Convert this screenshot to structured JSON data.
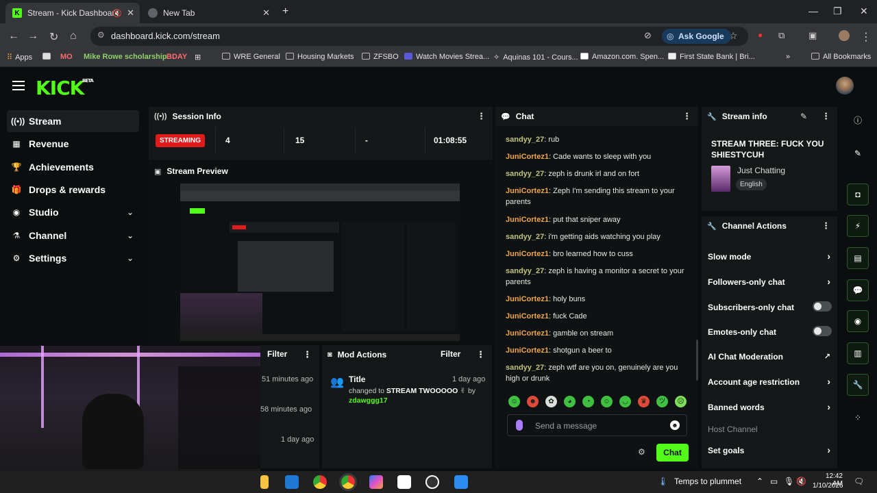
{
  "browser": {
    "tabs": [
      {
        "title": "Stream - Kick Dashboard",
        "active": true
      },
      {
        "title": "New Tab",
        "active": false
      }
    ],
    "url": "dashboard.kick.com/stream",
    "ask_google": "Ask Google",
    "bookmarks": [
      "Apps",
      "MO",
      "Mike Rowe scholarship",
      "BDAY",
      "WRE General",
      "Housing Markets",
      "ZFSBO",
      "Watch Movies Strea...",
      "Aquinas 101 - Cours...",
      "Amazon.com. Spen...",
      "First State Bank | Bri...",
      "All Bookmarks"
    ]
  },
  "app": {
    "logo": "KICK",
    "logo_beta": "BETA",
    "nav": [
      {
        "label": "Stream",
        "icon": "stream-icon",
        "active": true
      },
      {
        "label": "Revenue",
        "icon": "revenue-icon"
      },
      {
        "label": "Achievements",
        "icon": "trophy-icon"
      },
      {
        "label": "Drops & rewards",
        "icon": "gift-icon"
      },
      {
        "label": "Studio",
        "icon": "studio-icon",
        "expandable": true
      },
      {
        "label": "Channel",
        "icon": "channel-icon",
        "expandable": true
      },
      {
        "label": "Settings",
        "icon": "gear-icon",
        "expandable": true
      }
    ],
    "session": {
      "title": "Session Info",
      "status": "STREAMING",
      "viewers": "4",
      "followers": "15",
      "subs": "-",
      "duration": "01:08:55"
    },
    "preview": {
      "title": "Stream Preview"
    },
    "activity": {
      "filter_label": "Filter",
      "times": [
        "51 minutes ago",
        "58 minutes ago",
        "1 day ago"
      ]
    },
    "mod_actions": {
      "title": "Mod Actions",
      "filter_label": "Filter",
      "entry_title": "Title",
      "entry_time": "1 day ago",
      "entry_prefix": "changed to",
      "entry_value": "STREAM TWOOOOO",
      "entry_by": "by",
      "entry_user": "zdawggg17"
    },
    "chat": {
      "title": "Chat",
      "messages": [
        {
          "user": "sandyy_27",
          "text": "rub"
        },
        {
          "user": "JuniCortez1",
          "text": "Cade wants to sleep with you"
        },
        {
          "user": "sandyy_27",
          "text": "zeph is drunk irl and on fort"
        },
        {
          "user": "JuniCortez1",
          "text": "Zeph I'm sending this stream to your parents"
        },
        {
          "user": "JuniCortez1",
          "text": "put that sniper away"
        },
        {
          "user": "sandyy_27",
          "text": "i'm getting aids watching you play"
        },
        {
          "user": "JuniCortez1",
          "text": "bro learned how to cuss"
        },
        {
          "user": "sandyy_27",
          "text": "zeph is having a monitor a secret to your parents"
        },
        {
          "user": "JuniCortez1",
          "text": "holy buns"
        },
        {
          "user": "JuniCortez1",
          "text": "fuck Cade"
        },
        {
          "user": "JuniCortez1",
          "text": "gamble on stream"
        },
        {
          "user": "JuniCortez1",
          "text": "shotgun a beer to"
        },
        {
          "user": "sandyy_27",
          "text": "zeph wtf are you on, genuinely are you high or drunk"
        }
      ],
      "placeholder": "Send a message",
      "send_label": "Chat"
    },
    "stream_info": {
      "title": "Stream info",
      "stream_title": "STREAM THREE: FUCK YOU SHIESTYCUH",
      "category": "Just Chatting",
      "language": "English"
    },
    "channel_actions": {
      "title": "Channel Actions",
      "items": [
        {
          "label": "Slow mode",
          "control": "chevron"
        },
        {
          "label": "Followers-only chat",
          "control": "chevron"
        },
        {
          "label": "Subscribers-only chat",
          "control": "toggle",
          "on": false
        },
        {
          "label": "Emotes-only chat",
          "control": "toggle",
          "on": false
        },
        {
          "label": "AI Chat Moderation",
          "control": "external"
        },
        {
          "label": "Account age restriction",
          "control": "chevron"
        },
        {
          "label": "Banned words",
          "control": "chevron"
        },
        {
          "label": "Host Channel",
          "control": "none",
          "disabled": true
        },
        {
          "label": "Set goals",
          "control": "chevron"
        }
      ]
    }
  },
  "taskbar": {
    "weather": "Temps to plummet",
    "time": "12:42 AM",
    "date": "1/10/2026"
  },
  "colors": {
    "kick_green": "#53fc18",
    "streaming_red": "#e11b1b"
  }
}
